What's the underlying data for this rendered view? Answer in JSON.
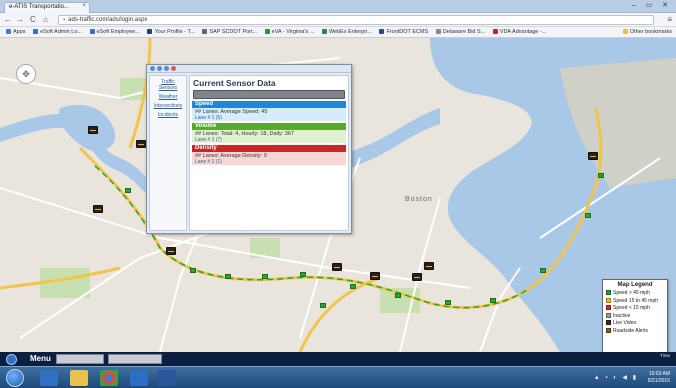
{
  "browser": {
    "tab_title": "e-ATIS Transportatio...",
    "tab_close": "×",
    "back": "←",
    "forward": "→",
    "reload": "C",
    "home": "⌂",
    "url": "ads-traffic.com/ads/login.aspx",
    "menu": "≡",
    "bookmarks": [
      {
        "label": "Apps",
        "color": "#4a7bd0"
      },
      {
        "label": "eSoft Admin Lo...",
        "color": "#3a6fc0"
      },
      {
        "label": "eSoft Employee...",
        "color": "#3a6fc0"
      },
      {
        "label": "Your Profile - T...",
        "color": "#1d3f8a"
      },
      {
        "label": "SAP SCDOT Port...",
        "color": "#666666"
      },
      {
        "label": "eVA - Virginia's ...",
        "color": "#3a8a3a"
      },
      {
        "label": "WebEx Enterpri...",
        "color": "#2a8a3a"
      },
      {
        "label": "FrontDOT ECMS",
        "color": "#2a4a8a"
      },
      {
        "label": "Delaware Bid S...",
        "color": "#888888"
      },
      {
        "label": "VDA Advantage -...",
        "color": "#b03030"
      }
    ],
    "other_bookmarks": "Other bookmarks"
  },
  "map": {
    "city_label": "Boston"
  },
  "sensor_window": {
    "title": "Current Sensor Data",
    "side_links": [
      "Traffic Sensors",
      "Weather",
      "Intersections",
      "Incidents"
    ],
    "sections": [
      {
        "name": "Speed",
        "color": "#1e88d6",
        "bg": "#d6ecfb",
        "line": "## Lanes: Average Speed: 45",
        "link": "Lane # 1 (5)"
      },
      {
        "name": "Volume",
        "color": "#5aa830",
        "bg": "#dff1d0",
        "line": "## Lanes: Total: 4, Hourly: 18, Daily: 367",
        "link": "Lane # 1 (7)"
      },
      {
        "name": "Density",
        "color": "#c62828",
        "bg": "#f8d6d6",
        "line": "## Lanes: Average Density: 0",
        "link": "Lane # 1 (1)"
      }
    ]
  },
  "legend": {
    "title": "Map Legend",
    "items": [
      {
        "label": "Speed > 45 mph",
        "color": "#22a033"
      },
      {
        "label": "Speed 15 to 45 mph",
        "color": "#e6c21a"
      },
      {
        "label": "Speed < 15 mph",
        "color": "#d12b2b"
      },
      {
        "label": "Inactive",
        "color": "#9a9a9a"
      },
      {
        "label": "Live Video",
        "color": "#2c2c2c"
      },
      {
        "label": "Roadside Alerts",
        "color": "#8a5a1a"
      }
    ]
  },
  "app_bar": {
    "menu_label": "Menu",
    "right_text": "Time"
  },
  "taskbar": {
    "clock_time": "10:03 AM",
    "clock_date": "5/21/2015"
  }
}
